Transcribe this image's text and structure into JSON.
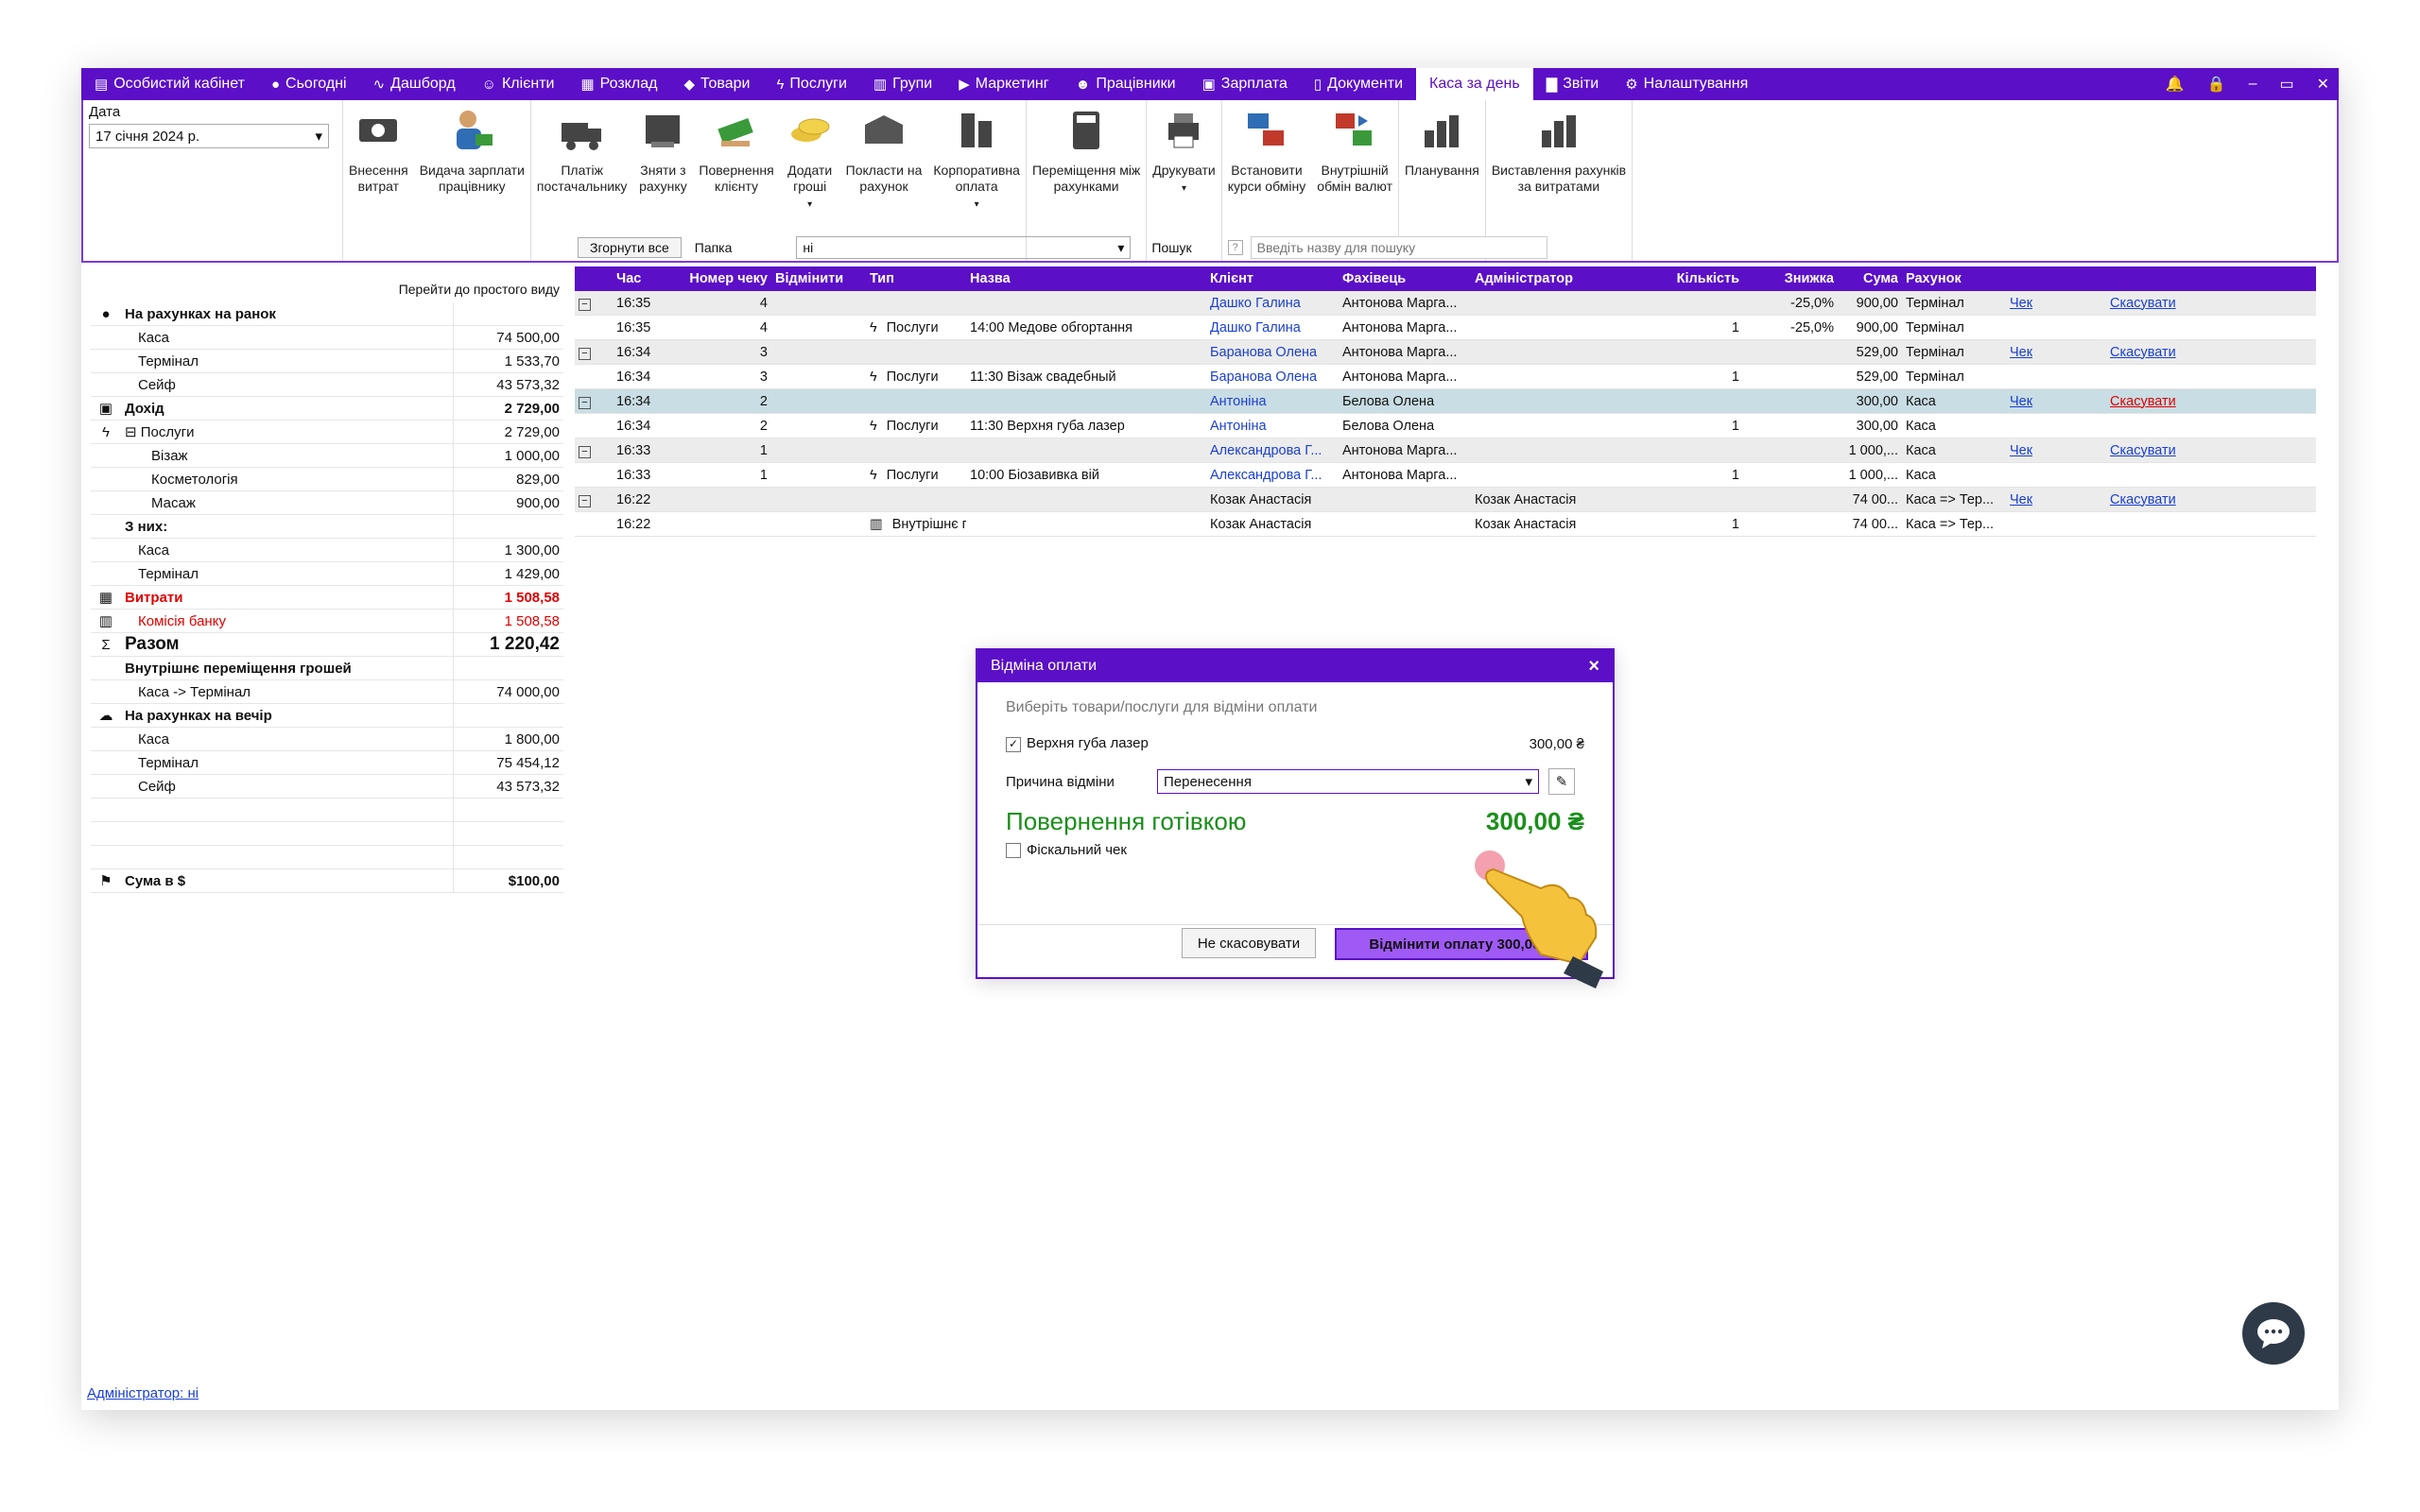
{
  "nav": {
    "items": [
      {
        "icon": "▤",
        "label": "Особистий кабінет"
      },
      {
        "icon": "●",
        "label": "Сьогодні"
      },
      {
        "icon": "∿",
        "label": "Дашборд"
      },
      {
        "icon": "☺",
        "label": "Клієнти"
      },
      {
        "icon": "▦",
        "label": "Розклад"
      },
      {
        "icon": "◆",
        "label": "Товари"
      },
      {
        "icon": "ϟ",
        "label": "Послуги"
      },
      {
        "icon": "▥",
        "label": "Групи"
      },
      {
        "icon": "▶",
        "label": "Маркетинг"
      },
      {
        "icon": "☻",
        "label": "Працівники"
      },
      {
        "icon": "▣",
        "label": "Зарплата"
      },
      {
        "icon": "▯",
        "label": "Документи"
      },
      {
        "icon": "",
        "label": "Каса за день"
      },
      {
        "icon": "▇",
        "label": "Звіти"
      },
      {
        "icon": "⚙",
        "label": "Налаштування"
      }
    ]
  },
  "ribbon": {
    "date_label": "Дата",
    "date_value": "17 січня 2024 р.",
    "buttons": [
      {
        "line1": "Внесення",
        "line2": "витрат"
      },
      {
        "line1": "Видача зарплати",
        "line2": "працівнику"
      },
      {
        "line1": "Платіж",
        "line2": "постачальнику"
      },
      {
        "line1": "Зняти з",
        "line2": "рахунку"
      },
      {
        "line1": "Повернення",
        "line2": "клієнту"
      },
      {
        "line1": "Додати",
        "line2": "гроші"
      },
      {
        "line1": "Покласти на",
        "line2": "рахунок"
      },
      {
        "line1": "Корпоративна",
        "line2": "оплата"
      },
      {
        "line1": "Переміщення між",
        "line2": "рахунками"
      },
      {
        "line1": "Друкувати",
        "line2": ""
      },
      {
        "line1": "Встановити",
        "line2": "курси обміну"
      },
      {
        "line1": "Внутрішній",
        "line2": "обмін валют"
      },
      {
        "line1": "Планування",
        "line2": ""
      },
      {
        "line1": "Виставлення рахунків",
        "line2": "за витратами"
      }
    ]
  },
  "left": {
    "simple_view_link": "Перейти до простого виду",
    "rows": [
      {
        "icon": "●",
        "label": "На рахунках на ранок",
        "value": "",
        "style": "bold",
        "indent": 0
      },
      {
        "icon": "",
        "label": "Каса",
        "value": "74 500,00",
        "style": "",
        "indent": 1
      },
      {
        "icon": "",
        "label": "Термінал",
        "value": "1 533,70",
        "style": "",
        "indent": 1
      },
      {
        "icon": "",
        "label": "Сейф",
        "value": "43 573,32",
        "style": "",
        "indent": 1
      },
      {
        "icon": "▣",
        "label": "Дохід",
        "value": "2 729,00",
        "style": "bold",
        "indent": 0
      },
      {
        "icon": "ϟ",
        "label": "⊟ Послуги",
        "value": "2 729,00",
        "style": "",
        "indent": 0
      },
      {
        "icon": "",
        "label": "Візаж",
        "value": "1 000,00",
        "style": "",
        "indent": 2
      },
      {
        "icon": "",
        "label": "Косметологія",
        "value": "829,00",
        "style": "",
        "indent": 2
      },
      {
        "icon": "",
        "label": "Масаж",
        "value": "900,00",
        "style": "",
        "indent": 2
      },
      {
        "icon": "",
        "label": "З них:",
        "value": "",
        "style": "bold",
        "indent": 0
      },
      {
        "icon": "",
        "label": "Каса",
        "value": "1 300,00",
        "style": "",
        "indent": 1
      },
      {
        "icon": "",
        "label": "Термінал",
        "value": "1 429,00",
        "style": "",
        "indent": 1
      },
      {
        "icon": "▦",
        "label": "Витрати",
        "value": "1 508,58",
        "style": "bold red",
        "indent": 0
      },
      {
        "icon": "▥",
        "label": "Комісія банку",
        "value": "1 508,58",
        "style": "red",
        "indent": 1
      },
      {
        "icon": "Σ",
        "label": "Разом",
        "value": "1 220,42",
        "style": "bold big",
        "indent": 0
      },
      {
        "icon": "",
        "label": "Внутрішнє переміщення грошей",
        "value": "",
        "style": "bold",
        "indent": 0
      },
      {
        "icon": "",
        "label": "Каса -> Термінал",
        "value": "74 000,00",
        "style": "",
        "indent": 1
      },
      {
        "icon": "☁",
        "label": "На рахунках на вечір",
        "value": "",
        "style": "bold",
        "indent": 0
      },
      {
        "icon": "",
        "label": "Каса",
        "value": "1 800,00",
        "style": "",
        "indent": 1
      },
      {
        "icon": "",
        "label": "Термінал",
        "value": "75 454,12",
        "style": "",
        "indent": 1
      },
      {
        "icon": "",
        "label": "Сейф",
        "value": "43 573,32",
        "style": "",
        "indent": 1
      },
      {
        "icon": "",
        "label": "",
        "value": "",
        "style": "",
        "indent": 0
      },
      {
        "icon": "",
        "label": "",
        "value": "",
        "style": "",
        "indent": 0
      },
      {
        "icon": "",
        "label": "",
        "value": "",
        "style": "",
        "indent": 0
      },
      {
        "icon": "⚑",
        "label": "Сума в $",
        "value": "$100,00",
        "style": "bold",
        "indent": 0
      }
    ]
  },
  "toolbar": {
    "collapse_all": "Згорнути все",
    "folder_label": "Папка",
    "folder_value": "ні",
    "search_label": "Пошук",
    "search_placeholder": "Введіть назву для пошуку"
  },
  "grid": {
    "headers": [
      "",
      "Час",
      "Номер чеку",
      "Відмінити",
      "Тип",
      "Назва",
      "Клієнт",
      "Фахівець",
      "Адміністратор",
      "Кількість",
      "Знижка",
      "Сума",
      "Рахунок",
      "",
      ""
    ],
    "rows": [
      {
        "kind": "group",
        "cells": [
          "⊟",
          "16:35",
          "4",
          "",
          "",
          "",
          "Дашко Галина",
          "Антонова Марга...",
          "",
          "",
          "-25,0%",
          "900,00",
          "Термінал",
          "Чек",
          "Скасувати"
        ]
      },
      {
        "kind": "item",
        "cells": [
          "",
          "16:35",
          "4",
          "",
          "Послуги",
          "14:00 Медове обгортання",
          "Дашко Галина",
          "Антонова Марга...",
          "",
          "1",
          "-25,0%",
          "900,00",
          "Термінал",
          "",
          ""
        ]
      },
      {
        "kind": "group",
        "cells": [
          "⊟",
          "16:34",
          "3",
          "",
          "",
          "",
          "Баранова Олена",
          "Антонова Марга...",
          "",
          "",
          "",
          "529,00",
          "Термінал",
          "Чек",
          "Скасувати"
        ]
      },
      {
        "kind": "item",
        "cells": [
          "",
          "16:34",
          "3",
          "",
          "Послуги",
          "11:30 Візаж свадебный",
          "Баранова Олена",
          "Антонова Марга...",
          "",
          "1",
          "",
          "529,00",
          "Термінал",
          "",
          ""
        ]
      },
      {
        "kind": "sel",
        "cells": [
          "⊟",
          "16:34",
          "2",
          "",
          "",
          "",
          "Антоніна",
          "Белова Олена",
          "",
          "",
          "",
          "300,00",
          "Каса",
          "Чек",
          "Скасувати"
        ]
      },
      {
        "kind": "item",
        "cells": [
          "",
          "16:34",
          "2",
          "",
          "Послуги",
          "11:30 Верхня губа лазер",
          "Антоніна",
          "Белова Олена",
          "",
          "1",
          "",
          "300,00",
          "Каса",
          "",
          ""
        ]
      },
      {
        "kind": "group",
        "cells": [
          "⊟",
          "16:33",
          "1",
          "",
          "",
          "",
          "Александрова Г...",
          "Антонова Марга...",
          "",
          "",
          "",
          "1 000,...",
          "Каса",
          "Чек",
          "Скасувати"
        ]
      },
      {
        "kind": "item",
        "cells": [
          "",
          "16:33",
          "1",
          "",
          "Послуги",
          "10:00 Біозавивка вій",
          "Александрова Г...",
          "Антонова Марга...",
          "",
          "1",
          "",
          "1 000,...",
          "Каса",
          "",
          ""
        ]
      },
      {
        "kind": "group",
        "cells": [
          "⊟",
          "16:22",
          "",
          "",
          "",
          "",
          "Козак Анастасія",
          "",
          "Козак Анастасія",
          "",
          "",
          "74 00...",
          "Каса => Тер...",
          "Чек",
          "Скасувати"
        ]
      },
      {
        "kind": "item2",
        "cells": [
          "",
          "16:22",
          "",
          "",
          "Внутрішнє п...",
          "",
          "Козак Анастасія",
          "",
          "Козак Анастасія",
          "1",
          "",
          "74 00...",
          "Каса => Тер...",
          "",
          ""
        ]
      }
    ]
  },
  "dialog": {
    "title": "Відміна оплати",
    "hint": "Виберіть товари/послуги для відміни оплати",
    "item_label": "Верхня губа лазер",
    "item_amount": "300,00 ₴",
    "reason_label": "Причина відміни",
    "reason_value": "Перенесення",
    "refund_label": "Повернення готівкою",
    "refund_amount": "300,00 ₴",
    "fiscal_label": "Фіскальний чек",
    "cancel_btn": "Не скасовувати",
    "confirm_btn": "Відмінити оплату 300,00 ₴"
  },
  "footer": {
    "admin_link": "Адміністратор: ні"
  },
  "colors": {
    "accent": "#5b0fc7",
    "income_red": "#e00000",
    "refund_green": "#1a8f1a",
    "link_blue": "#1a3fd0"
  }
}
